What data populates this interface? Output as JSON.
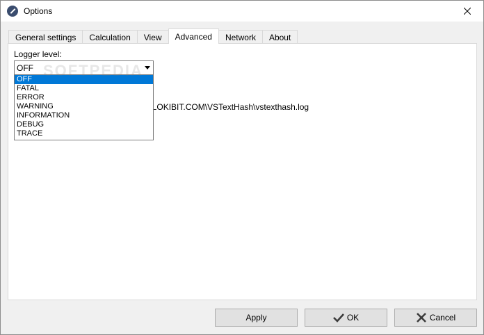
{
  "window": {
    "title": "Options",
    "app_icon": "gauge-icon",
    "close_icon": "close-icon"
  },
  "tabs": [
    {
      "label": "General settings",
      "active": false
    },
    {
      "label": "Calculation",
      "active": false
    },
    {
      "label": "View",
      "active": false
    },
    {
      "label": "Advanced",
      "active": true
    },
    {
      "label": "Network",
      "active": false
    },
    {
      "label": "About",
      "active": false
    }
  ],
  "advanced": {
    "logger_label": "Logger level:",
    "logger_value": "OFF",
    "logger_options": [
      "OFF",
      "FATAL",
      "ERROR",
      "WARNING",
      "INFORMATION",
      "DEBUG",
      "TRACE"
    ],
    "log_path_partial": "ng\\LOKIBIT.COM\\VSTextHash\\vstexthash.log"
  },
  "watermark": "SOFTPEDIA",
  "buttons": {
    "apply": "Apply",
    "ok": "OK",
    "cancel": "Cancel"
  },
  "colors": {
    "selection": "#0078d7",
    "window_bg": "#f0f0f0",
    "panel_bg": "#ffffff"
  }
}
